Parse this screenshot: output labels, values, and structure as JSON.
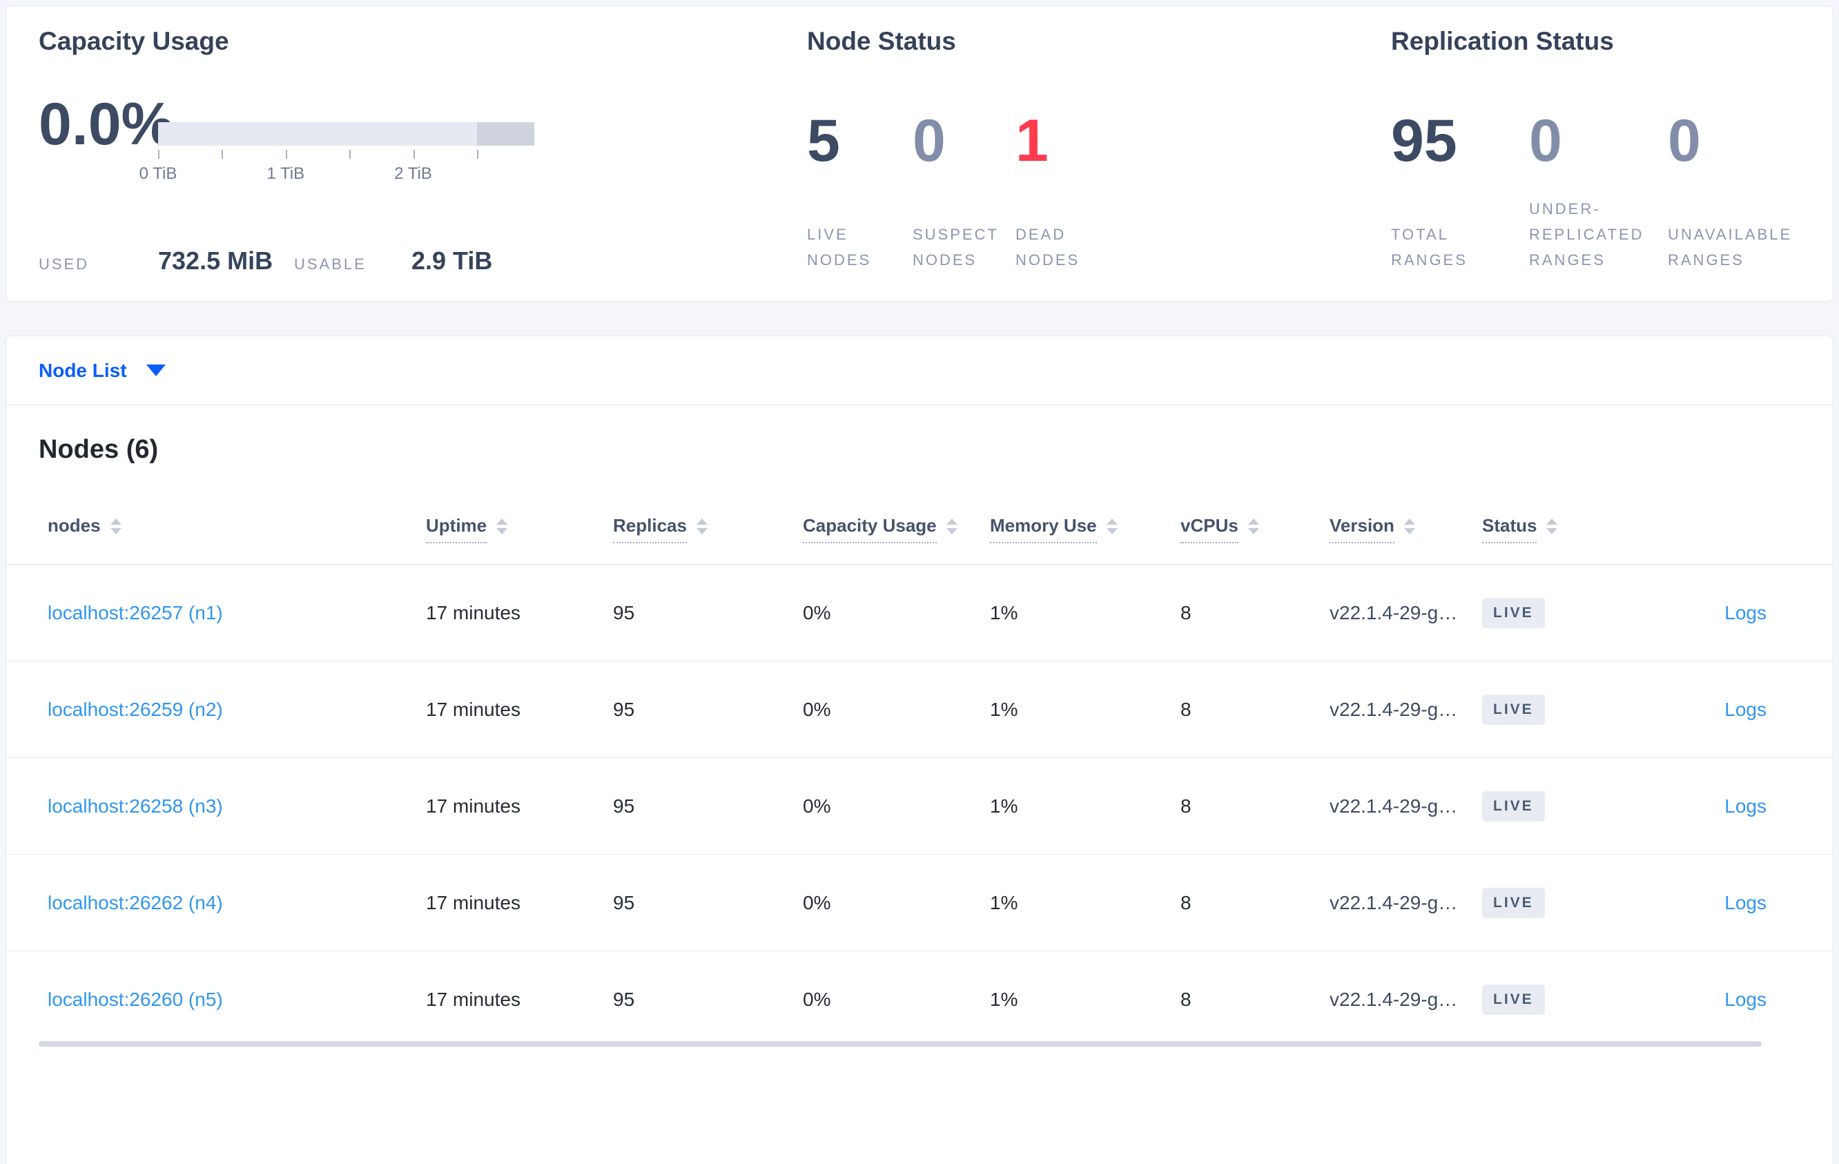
{
  "colors": {
    "page_bg": "#f4f6fa",
    "card_border": "#e2e6ee",
    "accent_blue": "#0b5ef8",
    "link_blue": "#2f96f2",
    "danger_red": "#ff3b4e",
    "dark_slate": "#3c4a63",
    "muted_slate": "#828da9",
    "label_gray": "#8c96b0",
    "badge_bg": "#e8ecf2",
    "bar_track": "#e6e9f2",
    "bar_dark": "#ced3df"
  },
  "stats": {
    "capacity": {
      "title": "Capacity Usage",
      "percent": "0.0%",
      "used_label": "USED",
      "used_value": "732.5 MiB",
      "usable_label": "USABLE",
      "usable_value": "2.9 TiB",
      "ticks": [
        "0 TiB",
        "1 TiB",
        "2 TiB"
      ]
    },
    "node_status": {
      "title": "Node Status",
      "metrics": [
        {
          "value": "5",
          "label": "LIVE NODES"
        },
        {
          "value": "0",
          "label": "SUSPECT NODES"
        },
        {
          "value": "1",
          "label": "DEAD NODES"
        }
      ]
    },
    "replication": {
      "title": "Replication Status",
      "metrics": [
        {
          "value": "95",
          "label": "TOTAL RANGES"
        },
        {
          "value": "0",
          "label": "UNDER-REPLICATED RANGES"
        },
        {
          "value": "0",
          "label": "UNAVAILABLE RANGES"
        }
      ]
    }
  },
  "node_list": {
    "dropdown_label": "Node List",
    "section_title": "Nodes (6)",
    "columns": [
      "nodes",
      "Uptime",
      "Replicas",
      "Capacity Usage",
      "Memory Use",
      "vCPUs",
      "Version",
      "Status"
    ],
    "rows": [
      {
        "node": "localhost:26257 (n1)",
        "uptime": "17 minutes",
        "replicas": "95",
        "capacity": "0%",
        "memory": "1%",
        "vcpus": "8",
        "version": "v22.1.4-29-g…",
        "status": "LIVE",
        "logs": "Logs"
      },
      {
        "node": "localhost:26259 (n2)",
        "uptime": "17 minutes",
        "replicas": "95",
        "capacity": "0%",
        "memory": "1%",
        "vcpus": "8",
        "version": "v22.1.4-29-g…",
        "status": "LIVE",
        "logs": "Logs"
      },
      {
        "node": "localhost:26258 (n3)",
        "uptime": "17 minutes",
        "replicas": "95",
        "capacity": "0%",
        "memory": "1%",
        "vcpus": "8",
        "version": "v22.1.4-29-g…",
        "status": "LIVE",
        "logs": "Logs"
      },
      {
        "node": "localhost:26262 (n4)",
        "uptime": "17 minutes",
        "replicas": "95",
        "capacity": "0%",
        "memory": "1%",
        "vcpus": "8",
        "version": "v22.1.4-29-g…",
        "status": "LIVE",
        "logs": "Logs"
      },
      {
        "node": "localhost:26260 (n5)",
        "uptime": "17 minutes",
        "replicas": "95",
        "capacity": "0%",
        "memory": "1%",
        "vcpus": "8",
        "version": "v22.1.4-29-g…",
        "status": "LIVE",
        "logs": "Logs"
      }
    ]
  }
}
